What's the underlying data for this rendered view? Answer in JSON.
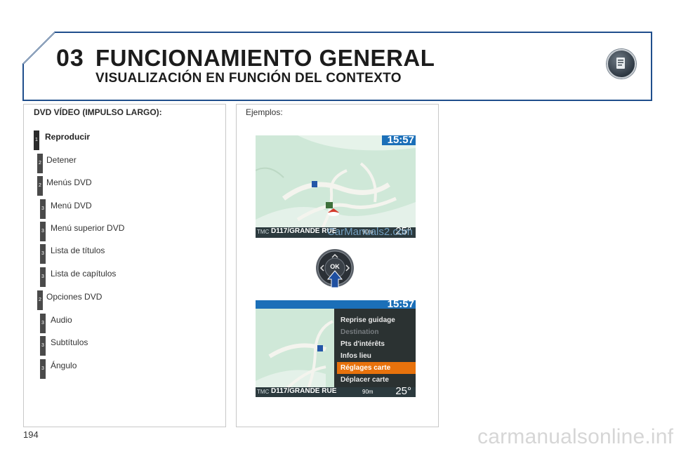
{
  "header": {
    "chapter_number": "03",
    "title": "FUNCIONAMIENTO GENERAL",
    "subtitle": "VISUALIZACIÓN EN FUNCIÓN DEL CONTEXTO",
    "icon": "book-icon"
  },
  "left_panel": {
    "section_title": "DVD VÍDEO (IMPULSO LARGO):",
    "items": [
      {
        "level": "1",
        "label": "Reproducir"
      },
      {
        "level": "2",
        "label": "Detener"
      },
      {
        "level": "2",
        "label": "Menús DVD"
      },
      {
        "level": "3",
        "label": "Menú DVD"
      },
      {
        "level": "3",
        "label": "Menú superior DVD"
      },
      {
        "level": "3",
        "label": "Lista de títulos"
      },
      {
        "level": "3",
        "label": "Lista de capítulos"
      },
      {
        "level": "2",
        "label": "Opciones DVD"
      },
      {
        "level": "3",
        "label": "Audio"
      },
      {
        "level": "3",
        "label": "Subtítulos"
      },
      {
        "level": "3",
        "label": "Ángulo"
      }
    ]
  },
  "right_panel": {
    "label": "Ejemplos:",
    "screen1": {
      "clock": "15:57",
      "street": "D117/GRANDE RUE",
      "tmc": "TMC",
      "distance": "90m",
      "temperature": "25°"
    },
    "knob_label": "OK",
    "screen2": {
      "clock": "15:57",
      "street": "D117/GRANDE RUE",
      "tmc": "TMC",
      "distance": "90m",
      "temperature": "25°",
      "menu_items": [
        {
          "label": "Reprise guidage",
          "state": "normal"
        },
        {
          "label": "Destination",
          "state": "disabled"
        },
        {
          "label": "Pts d'intérêts",
          "state": "normal"
        },
        {
          "label": "Infos lieu",
          "state": "normal"
        },
        {
          "label": "Réglages carte",
          "state": "selected"
        },
        {
          "label": "Déplacer carte",
          "state": "normal"
        }
      ]
    }
  },
  "watermark_overlay": "CarManuals2.com",
  "page_number": "194",
  "footer_watermark": "carmanualsonline.info",
  "colors": {
    "accent_blue": "#1f4e8c",
    "highlight_orange": "#e8720c",
    "badge_dark": "#4a4a4a"
  }
}
